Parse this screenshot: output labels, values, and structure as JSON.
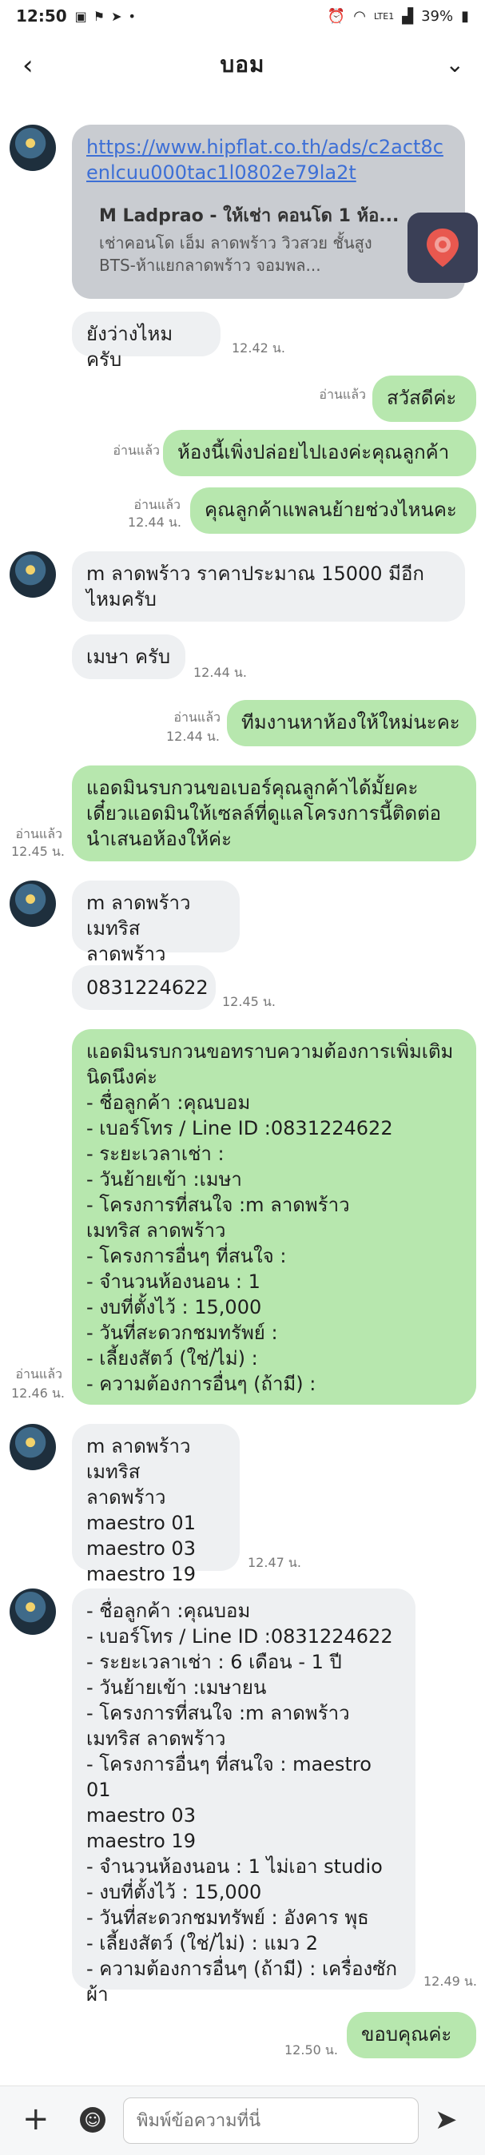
{
  "status": {
    "time": "12:50",
    "battery": "39%",
    "signal": "LTE1",
    "icons": [
      "image-icon",
      "flag-icon",
      "send-icon",
      "dot-icon",
      "alarm-icon",
      "wifi-icon"
    ]
  },
  "header": {
    "title": "บอม"
  },
  "messages": {
    "link_url": "https://www.hipflat.co.th/ads/c2act8cenlcuu000tac1l0802e79la2t",
    "card_title": "M Ladprao - ให้เช่า คอนโด 1 ห้อ...",
    "card_desc": "เช่าคอนโด เอ็ม ลาดพร้าว วิวสวย ชั้นสูง BTS-ห้าแยกลาดพร้าว จอมพล...",
    "m1": "ยังว่างไหมครับ",
    "t1": "12.42 น.",
    "m2": "สวัสดีค่ะ",
    "r2": "อ่านแล้ว",
    "m3": "ห้องนี้เพิ่งปล่อยไปเองค่ะคุณลูกค้า",
    "r3": "อ่านแล้ว",
    "m4": "คุณลูกค้าแพลนย้ายช่วงไหนคะ",
    "r4": "อ่านแล้ว",
    "t4": "12.44 น.",
    "m5": "m ลาดพร้าว ราคาประมาณ 15000 มีอีกไหมครับ",
    "m6": "เมษา ครับ",
    "t6": "12.44 น.",
    "m7": "ทีมงานหาห้องให้ใหม่นะคะ",
    "r7": "อ่านแล้ว",
    "t7": "12.44 น.",
    "m8": "แอดมินรบกวนขอเบอร์คุณลูกค้าได้มั้ยคะ เดี๋ยวแอดมินให้เซลล์ที่ดูแลโครงการนี้ติดต่อนำเสนอห้องให้ค่ะ",
    "r8": "อ่านแล้ว",
    "t8": "12.45 น.",
    "m9": "m ลาดพร้าว\nเมทริส ลาดพร้าว",
    "m10": "0831224622",
    "t10": "12.45 น.",
    "m11": "แอดมินรบกวนขอทราบความต้องการเพิ่มเติมนิดนึงค่ะ\n- ชื่อลูกค้า :คุณบอม\n- เบอร์โทร / Line ID :0831224622\n- ระยะเวลาเช่า :\n- วันย้ายเข้า :เมษา\n- โครงการที่สนใจ :m ลาดพร้าว\nเมทริส ลาดพร้าว\n- โครงการอื่นๆ ที่สนใจ :\n- จำนวนห้องนอน : 1\n- งบที่ตั้งไว้ : 15,000\n- วันที่สะดวกชมทรัพย์ :\n- เลี้ยงสัตว์ (ใช่/ไม่) :\n- ความต้องการอื่นๆ (ถ้ามี) :",
    "r11": "อ่านแล้ว",
    "t11": "12.46 น.",
    "m12": "m ลาดพร้าว\nเมทริส ลาดพร้าว\nmaestro 01\nmaestro 03\nmaestro 19",
    "t12": "12.47 น.",
    "m13": "- ชื่อลูกค้า :คุณบอม\n- เบอร์โทร / Line ID :0831224622\n- ระยะเวลาเช่า : 6 เดือน - 1 ปี\n- วันย้ายเข้า :เมษายน\n- โครงการที่สนใจ :m ลาดพร้าว\nเมทริส ลาดพร้าว\n- โครงการอื่นๆ ที่สนใจ : maestro 01\nmaestro 03\nmaestro 19\n- จำนวนห้องนอน : 1 ไม่เอา studio\n- งบที่ตั้งไว้ : 15,000\n- วันที่สะดวกชมทรัพย์ : อังคาร พุธ\n- เลี้ยงสัตว์ (ใช่/ไม่) : แมว 2\n- ความต้องการอื่นๆ (ถ้ามี) : เครื่องซักผ้า",
    "t13": "12.49 น.",
    "m14": "ขอบคุณค่ะ",
    "t14": "12.50 น."
  },
  "composer": {
    "placeholder": "พิมพ์ข้อความที่นี่"
  }
}
